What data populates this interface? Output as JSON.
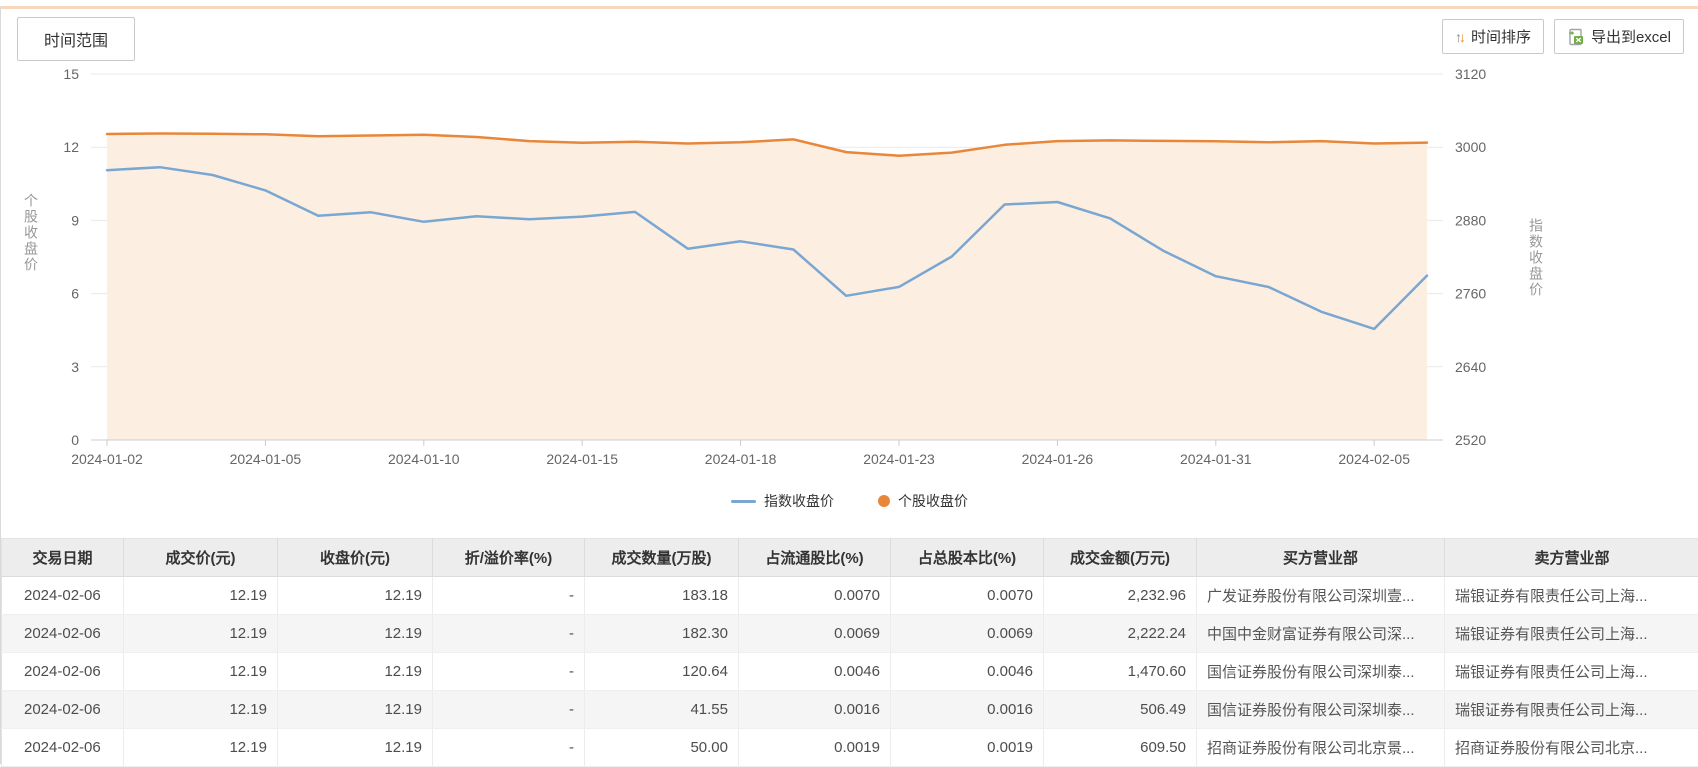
{
  "toolbar": {
    "time_range_label": "时间范围",
    "time_sort_label": "时间排序",
    "export_label": "导出到excel"
  },
  "chart_data": {
    "type": "line",
    "x": [
      "2024-01-02",
      "2024-01-03",
      "2024-01-04",
      "2024-01-05",
      "2024-01-08",
      "2024-01-09",
      "2024-01-10",
      "2024-01-11",
      "2024-01-12",
      "2024-01-15",
      "2024-01-16",
      "2024-01-17",
      "2024-01-18",
      "2024-01-19",
      "2024-01-22",
      "2024-01-23",
      "2024-01-24",
      "2024-01-25",
      "2024-01-26",
      "2024-01-29",
      "2024-01-30",
      "2024-01-31",
      "2024-02-01",
      "2024-02-02",
      "2024-02-05",
      "2024-02-06"
    ],
    "x_label_interval": 3,
    "series": [
      {
        "name": "指数收盘价",
        "axis": "right",
        "color": "#7aa6d2",
        "values": [
          2962.28,
          2967.25,
          2954.35,
          2929.18,
          2887.54,
          2893.25,
          2877.7,
          2886.65,
          2881.98,
          2886.29,
          2893.99,
          2833.62,
          2845.78,
          2832.28,
          2756.34,
          2770.98,
          2820.77,
          2906.11,
          2910.22,
          2883.36,
          2830.53,
          2788.55,
          2770.74,
          2730.15,
          2702.19,
          2789.49
        ]
      },
      {
        "name": "个股收盘价",
        "axis": "left",
        "color": "#e8873a",
        "area_color": "#fcefe2",
        "values": [
          12.54,
          12.56,
          12.55,
          12.53,
          12.45,
          12.48,
          12.51,
          12.42,
          12.25,
          12.18,
          12.22,
          12.15,
          12.2,
          12.32,
          11.8,
          11.65,
          11.78,
          12.1,
          12.25,
          12.28,
          12.26,
          12.24,
          12.2,
          12.25,
          12.15,
          12.19
        ]
      }
    ],
    "left_axis": {
      "name": "个股收盘价",
      "min": 0,
      "max": 15,
      "ticks": [
        0,
        3,
        6,
        9,
        12,
        15
      ]
    },
    "right_axis": {
      "name": "指数收盘价",
      "min": 2520,
      "max": 3120,
      "ticks": [
        2520,
        2640,
        2760,
        2880,
        3000,
        3120
      ]
    },
    "legend": [
      "指数收盘价",
      "个股收盘价"
    ],
    "grid": true,
    "legend_position": "bottom"
  },
  "table": {
    "columns": [
      "交易日期",
      "成交价(元)",
      "收盘价(元)",
      "折/溢价率(%)",
      "成交数量(万股)",
      "占流通股比(%)",
      "占总股本比(%)",
      "成交金额(万元)",
      "买方营业部",
      "卖方营业部"
    ],
    "rows": [
      [
        "2024-02-06",
        "12.19",
        "12.19",
        "-",
        "183.18",
        "0.0070",
        "0.0070",
        "2,232.96",
        "广发证券股份有限公司深圳壹...",
        "瑞银证券有限责任公司上海..."
      ],
      [
        "2024-02-06",
        "12.19",
        "12.19",
        "-",
        "182.30",
        "0.0069",
        "0.0069",
        "2,222.24",
        "中国中金财富证券有限公司深...",
        "瑞银证券有限责任公司上海..."
      ],
      [
        "2024-02-06",
        "12.19",
        "12.19",
        "-",
        "120.64",
        "0.0046",
        "0.0046",
        "1,470.60",
        "国信证券股份有限公司深圳泰...",
        "瑞银证券有限责任公司上海..."
      ],
      [
        "2024-02-06",
        "12.19",
        "12.19",
        "-",
        "41.55",
        "0.0016",
        "0.0016",
        "506.49",
        "国信证券股份有限公司深圳泰...",
        "瑞银证券有限责任公司上海..."
      ],
      [
        "2024-02-06",
        "12.19",
        "12.19",
        "-",
        "50.00",
        "0.0019",
        "0.0019",
        "609.50",
        "招商证券股份有限公司北京景...",
        "招商证券股份有限公司北京..."
      ]
    ]
  }
}
